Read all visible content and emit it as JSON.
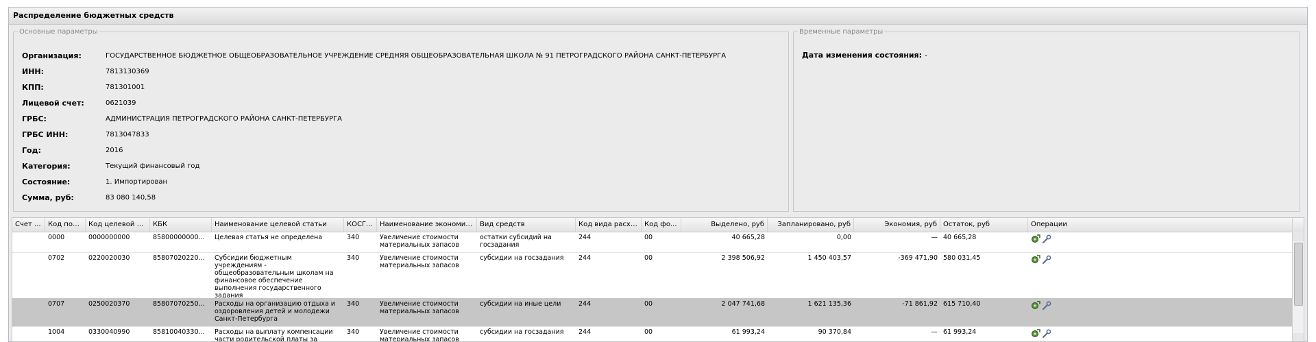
{
  "panel": {
    "title": "Распределение бюджетных средств"
  },
  "main_params": {
    "legend": "Основные параметры",
    "rows": [
      {
        "label": "Организация:",
        "value": "ГОСУДАРСТВЕННОЕ БЮДЖЕТНОЕ ОБЩЕОБРАЗОВАТЕЛЬНОЕ УЧРЕЖДЕНИЕ СРЕДНЯЯ ОБЩЕОБРАЗОВАТЕЛЬНАЯ ШКОЛА № 91 ПЕТРОГРАДСКОГО РАЙОНА САНКТ-ПЕТЕРБУРГА"
      },
      {
        "label": "ИНН:",
        "value": "7813130369"
      },
      {
        "label": "КПП:",
        "value": "781301001"
      },
      {
        "label": "Лицевой счет:",
        "value": "0621039"
      },
      {
        "label": "ГРБС:",
        "value": "АДМИНИСТРАЦИЯ ПЕТРОГРАДСКОГО РАЙОНА САНКТ-ПЕТЕРБУРГА"
      },
      {
        "label": "ГРБС ИНН:",
        "value": "7813047833"
      },
      {
        "label": "Год:",
        "value": "2016"
      },
      {
        "label": "Категория:",
        "value": "Текущий финансовый год"
      },
      {
        "label": "Состояние:",
        "value": "1. Импортирован"
      },
      {
        "label": "Сумма, руб:",
        "value": "83 080 140,58"
      }
    ]
  },
  "time_params": {
    "legend": "Временные параметры",
    "label": "Дата изменения состояния:",
    "value": "-"
  },
  "grid": {
    "columns": [
      "Счет ...",
      "Код под...",
      "Код целевой ст...",
      "КБК",
      "Наименование целевой статьи",
      "КОСГ...",
      "Наименование экономич...",
      "Вид средств",
      "Код вида расхо...",
      "Код фо...",
      "Выделено, руб",
      "Запланировано, руб",
      "Экономия, руб",
      "Остаток, руб",
      "Операции"
    ],
    "rows": [
      {
        "schet": "",
        "kod_pod": "0000",
        "kod_cel": "0000000000",
        "kbk": "8580000000000...",
        "naim_cel": "Целевая статья не определена",
        "kosgu": "340",
        "naim_econ": "Увеличение стоимости материальных запасов",
        "vid_sredstv": "остатки субсидий на госзадания",
        "kod_vida": "244",
        "kod_fo": "00",
        "vydeleno": "40 665,28",
        "zaplanirovano": "0,00",
        "economy": "—",
        "ostatok": "40 665,28",
        "selected": false
      },
      {
        "schet": "",
        "kod_pod": "0702",
        "kod_cel": "0220020030",
        "kbk": "8580702022002...",
        "naim_cel": "Субсидии бюджетным учреждениям - общеобразовательным школам на финансовое обеспечение выполнения государственного задания",
        "kosgu": "340",
        "naim_econ": "Увеличение стоимости материальных запасов",
        "vid_sredstv": "субсидии на госзадания",
        "kod_vida": "244",
        "kod_fo": "00",
        "vydeleno": "2 398 506,92",
        "zaplanirovano": "1 450 403,57",
        "economy": "-369 471,90",
        "ostatok": "580 031,45",
        "selected": false
      },
      {
        "schet": "",
        "kod_pod": "0707",
        "kod_cel": "0250020370",
        "kbk": "8580707025002...",
        "naim_cel": "Расходы на организацию отдыха и оздоровления детей и молодежи Санкт-Петербурга",
        "kosgu": "340",
        "naim_econ": "Увеличение стоимости материальных запасов",
        "vid_sredstv": "субсидии на иные цели",
        "kod_vida": "244",
        "kod_fo": "00",
        "vydeleno": "2 047 741,68",
        "zaplanirovano": "1 621 135,36",
        "economy": "-71 861,92",
        "ostatok": "615 710,40",
        "selected": true
      },
      {
        "schet": "",
        "kod_pod": "1004",
        "kod_cel": "0330040990",
        "kbk": "8581004033004...",
        "naim_cel": "Расходы на выплату компенсации части родительской платы за",
        "kosgu": "340",
        "naim_econ": "Увеличение стоимости материальных запасов",
        "vid_sredstv": "субсидии на госзадания",
        "kod_vida": "244",
        "kod_fo": "00",
        "vydeleno": "61 993,24",
        "zaplanirovano": "90 370,84",
        "economy": "—",
        "ostatok": "61 993,24",
        "selected": false
      }
    ]
  },
  "icons": {
    "add": "gear-add-icon",
    "edit": "wrench-icon"
  },
  "colors": {
    "panel_bg": "#ebebeb",
    "selected_row": "#c6c6c6",
    "border": "#b5b8c8"
  }
}
